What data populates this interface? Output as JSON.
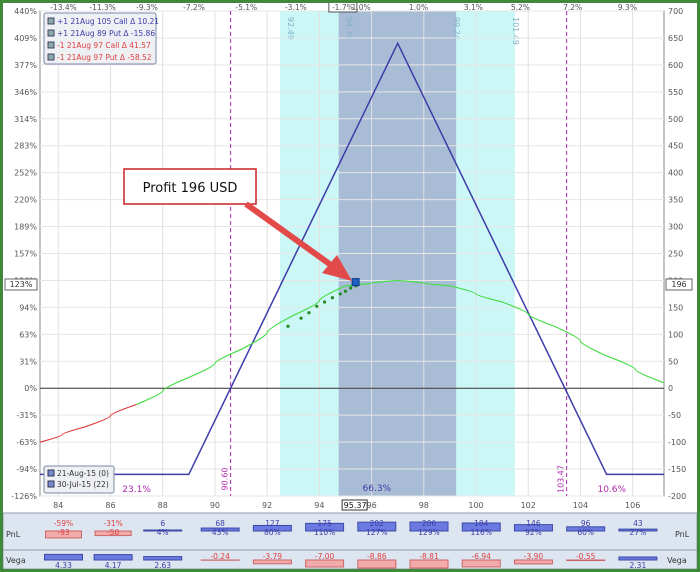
{
  "chart_data": {
    "type": "line",
    "x_axis": {
      "min": 83.3,
      "max": 107.2,
      "ticks": [
        84,
        86,
        88,
        90,
        92,
        94,
        96,
        98,
        100,
        102,
        104,
        106
      ],
      "current_price_label": "95.37",
      "current_price": 95.37
    },
    "top_axis": {
      "labels": [
        {
          "x": 84.2,
          "text": "-13.4%"
        },
        {
          "x": 85.7,
          "text": "-11.3%"
        },
        {
          "x": 87.4,
          "text": "-9.3%"
        },
        {
          "x": 89.2,
          "text": "-7.2%"
        },
        {
          "x": 91.2,
          "text": "-5.1%"
        },
        {
          "x": 93.1,
          "text": "-3.1%"
        },
        {
          "x": 94.9,
          "text": "-1.7%",
          "boxed": true
        },
        {
          "x": 95.6,
          "text": "1.0%"
        },
        {
          "x": 97.8,
          "text": "1.0%"
        },
        {
          "x": 99.9,
          "text": "3.1%"
        },
        {
          "x": 101.7,
          "text": "5.2%"
        },
        {
          "x": 103.7,
          "text": "7.2%"
        },
        {
          "x": 105.8,
          "text": "9.3%"
        }
      ]
    },
    "y_left": {
      "min": -126,
      "max": 440,
      "ticks": [
        "440%",
        "409%",
        "377%",
        "346%",
        "314%",
        "283%",
        "252%",
        "220%",
        "189%",
        "157%",
        "126%",
        "94%",
        "63%",
        "31%",
        "0%",
        "-31%",
        "-63%",
        "-94%",
        "-126%"
      ],
      "marker": "123%"
    },
    "y_right": {
      "min": -200,
      "max": 700,
      "ticks": [
        700,
        650,
        600,
        550,
        500,
        450,
        400,
        350,
        300,
        250,
        200,
        150,
        100,
        50,
        0,
        -50,
        -100,
        -150,
        -200
      ],
      "marker": "196"
    },
    "bands": [
      {
        "from": 92.49,
        "to": 101.49,
        "color": "#ccf7f7",
        "labels": [
          "92.49",
          "101.49"
        ]
      },
      {
        "from": 94.74,
        "to": 99.24,
        "color": "#a9bcd6",
        "labels": [
          "94.74",
          "99.24"
        ]
      }
    ],
    "vlines": [
      {
        "x": 90.6,
        "label": "90.60"
      },
      {
        "x": 103.47,
        "label": "103.47"
      }
    ],
    "zone_labels": [
      {
        "x": 87.0,
        "text": "23.1%"
      },
      {
        "x": 96.2,
        "text": "66.3%"
      },
      {
        "x": 105.2,
        "text": "10.6%"
      }
    ],
    "series": [
      {
        "name": "21-Aug-15 (0)",
        "color": "#3c3ca8",
        "x": [
          83.3,
          89.0,
          97.0,
          105.0,
          107.2
        ],
        "y": [
          -160,
          -160,
          640,
          -160,
          -160
        ]
      },
      {
        "name": "30-Jul-15 (22)",
        "color": "#44dd44",
        "x": [
          83.3,
          85.0,
          87.0,
          89.0,
          91.0,
          93.0,
          95.0,
          97.0,
          99.0,
          101.0,
          103.0,
          105.0,
          107.2
        ],
        "y": [
          -100,
          -72,
          -30,
          20,
          72,
          135,
          190,
          200,
          190,
          160,
          115,
          60,
          10
        ]
      }
    ],
    "scatter": {
      "color": "#228822",
      "points": [
        [
          92.8,
          115
        ],
        [
          93.3,
          130
        ],
        [
          93.6,
          140
        ],
        [
          93.9,
          152
        ],
        [
          94.2,
          160
        ],
        [
          94.5,
          168
        ],
        [
          94.8,
          175
        ],
        [
          95.0,
          180
        ],
        [
          95.2,
          186
        ],
        [
          95.4,
          190
        ]
      ]
    },
    "legend_top": [
      {
        "text": "+1 21Aug 105 Call Δ 10.21",
        "color": "#3c3ca8"
      },
      {
        "text": "+1 21Aug 89 Put Δ -15.86",
        "color": "#3c3ca8"
      },
      {
        "text": "-1 21Aug 97 Call Δ 41.57",
        "color": "#e04040"
      },
      {
        "text": "-1 21Aug 97 Put Δ -58.52",
        "color": "#e04040"
      }
    ],
    "legend_bottom": [
      {
        "text": "21-Aug-15 (0)"
      },
      {
        "text": "30-Jul-15 (22)"
      }
    ]
  },
  "annotation": {
    "text": "Profit 196 USD"
  },
  "bottom_table": {
    "pnl_label": "PnL",
    "vega_label": "Vega",
    "pnl": [
      {
        "x": 84.2,
        "top": "-59%",
        "bottom": "-93",
        "neg": true
      },
      {
        "x": 86.1,
        "top": "-31%",
        "bottom": "-50",
        "neg": true
      },
      {
        "x": 88.0,
        "top": "6",
        "bottom": "4%",
        "neg": false
      },
      {
        "x": 90.2,
        "top": "68",
        "bottom": "43%",
        "neg": false
      },
      {
        "x": 92.2,
        "top": "127",
        "bottom": "80%",
        "neg": false
      },
      {
        "x": 94.2,
        "top": "175",
        "bottom": "110%",
        "neg": false
      },
      {
        "x": 96.2,
        "top": "202",
        "bottom": "127%",
        "neg": false
      },
      {
        "x": 98.2,
        "top": "206",
        "bottom": "129%",
        "neg": false
      },
      {
        "x": 100.2,
        "top": "184",
        "bottom": "116%",
        "neg": false
      },
      {
        "x": 102.2,
        "top": "146",
        "bottom": "92%",
        "neg": false
      },
      {
        "x": 104.2,
        "top": "96",
        "bottom": "60%",
        "neg": false
      },
      {
        "x": 106.2,
        "top": "43",
        "bottom": "27%",
        "neg": false
      }
    ],
    "vega": [
      {
        "x": 84.2,
        "value": "4.33",
        "neg": false
      },
      {
        "x": 86.1,
        "value": "4.17",
        "neg": false
      },
      {
        "x": 88.0,
        "value": "2.63",
        "neg": false
      },
      {
        "x": 90.2,
        "value": "-0.24",
        "neg": true
      },
      {
        "x": 92.2,
        "value": "-3.79",
        "neg": true
      },
      {
        "x": 94.2,
        "value": "-7.00",
        "neg": true
      },
      {
        "x": 96.2,
        "value": "-8.86",
        "neg": true
      },
      {
        "x": 98.2,
        "value": "-8.81",
        "neg": true
      },
      {
        "x": 100.2,
        "value": "-6.94",
        "neg": true
      },
      {
        "x": 102.2,
        "value": "-3.90",
        "neg": true
      },
      {
        "x": 104.2,
        "value": "-0.55",
        "neg": true
      },
      {
        "x": 106.2,
        "value": "2.31",
        "neg": false
      }
    ]
  },
  "colors": {
    "frame": "#3f8a3a",
    "axis": "#555555",
    "neg_text": "#e04040",
    "pos_text": "#3c3ca8",
    "band_outer": "#ccf7f7",
    "band_inner": "#a9bcd6"
  }
}
